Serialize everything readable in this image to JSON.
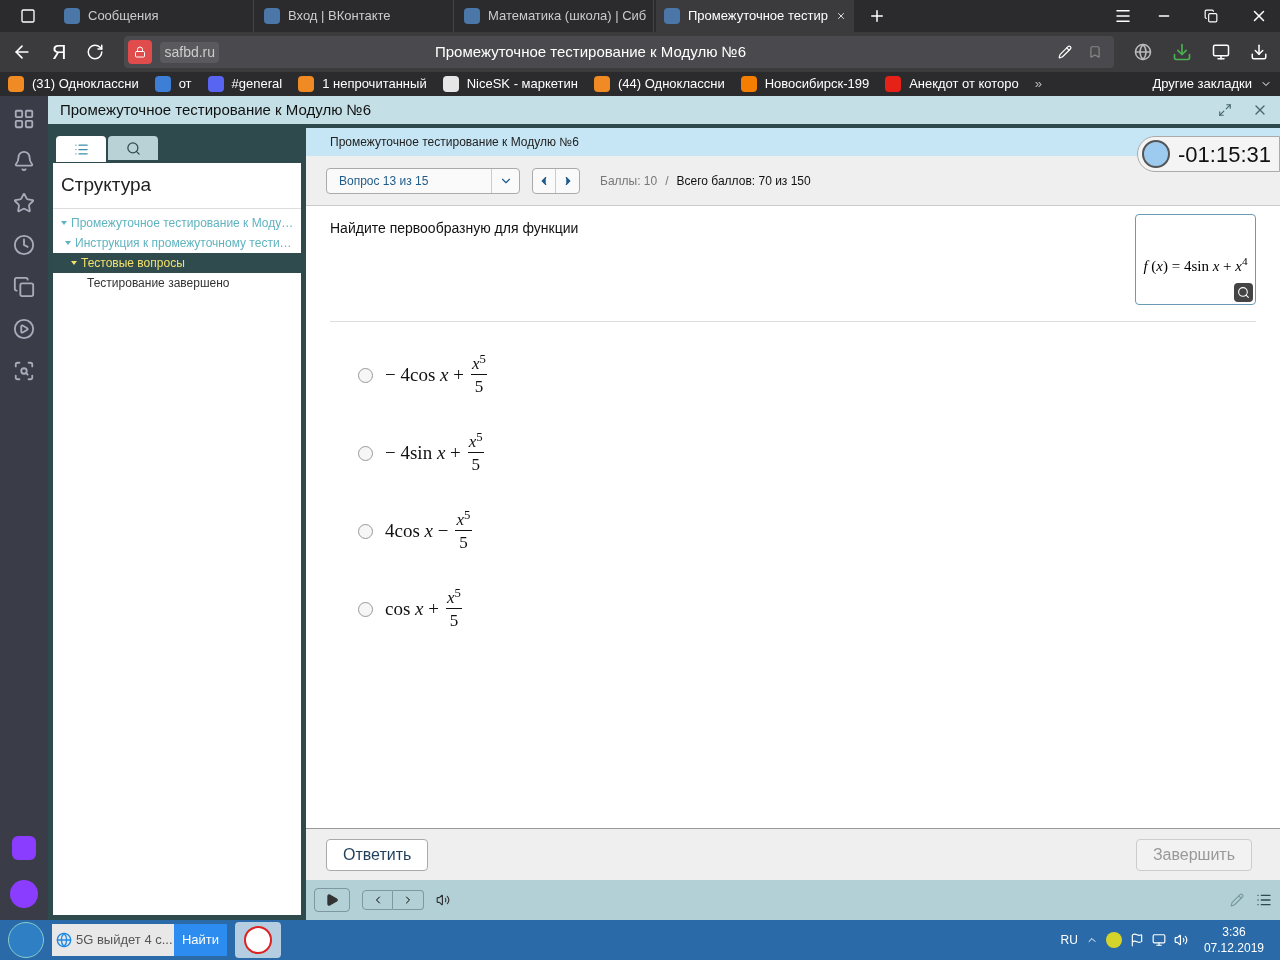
{
  "browser_tabs": [
    {
      "label": "Сообщения",
      "selected": false
    },
    {
      "label": "Вход | ВКонтакте",
      "selected": false
    },
    {
      "label": "Математика (школа) | Сиб",
      "selected": false
    },
    {
      "label": "Промежуточное тестир",
      "selected": true
    }
  ],
  "address_bar": {
    "domain": "safbd.ru",
    "page_title": "Промежуточное тестирование к Модулю №6"
  },
  "bookmarks": [
    {
      "label": "(31) Одноклассни",
      "color": "#f08a24"
    },
    {
      "label": "от",
      "color": "#3d7fd6"
    },
    {
      "label": "#general",
      "color": "#5865f2"
    },
    {
      "label": "1 непрочитанный",
      "color": "#f08a24"
    },
    {
      "label": "NiceSK - маркетин",
      "color": "#e6e6e6"
    },
    {
      "label": "(44) Одноклассни",
      "color": "#f08a24"
    },
    {
      "label": "Новосибирск-199",
      "color": "#f57d00"
    },
    {
      "label": "Анекдот от которо",
      "color": "#e62117"
    }
  ],
  "more_bookmarks": "»",
  "other_bookmarks": "Другие закладки",
  "browser_logo": "Я",
  "window": {
    "title": "Промежуточное тестирование к Модулю №6"
  },
  "panel_tabs": [
    {
      "kind": "list",
      "selected": true
    },
    {
      "kind": "search",
      "selected": false
    }
  ],
  "structure": {
    "title": "Структура",
    "items": [
      {
        "label": "Промежуточное тестирование к Моду…",
        "expanded": true,
        "selected": false,
        "children": [
          {
            "label": "Инструкция к промежуточному тести…",
            "expanded": true,
            "selected": false,
            "children": [
              {
                "label": "Тестовые вопросы",
                "expanded": true,
                "selected": true,
                "children": [
                  {
                    "label": "Тестирование завершено",
                    "expanded": false,
                    "selected": false
                  }
                ]
              }
            ]
          }
        ]
      }
    ]
  },
  "header": {
    "title": "Промежуточное тестирование к Модулю №6",
    "question_select": "Вопрос 13 из 15",
    "score": "Баллы: 10",
    "separator": "/",
    "total": "Всего баллов: 70 из 150",
    "timer": "-01:15:31"
  },
  "question": {
    "text": "Найдите первообразную для функции",
    "formula": "*f* (*x*) = 4sin *x* + *x*$^{4}$"
  },
  "options": [
    {
      "lead": "− 4cos *x* +",
      "numerator": "*x*$^{5}$",
      "denominator": "5",
      "selected": false
    },
    {
      "lead": "− 4sin *x* +",
      "numerator": "*x*$^{5}$",
      "denominator": "5",
      "selected": false
    },
    {
      "lead": "4cos *x* −",
      "numerator": "*x*$^{5}$",
      "denominator": "5",
      "selected": false
    },
    {
      "lead": "cos *x* +",
      "numerator": "*x*$^{5}$",
      "denominator": "5",
      "selected": false
    }
  ],
  "buttons": {
    "answer": "Ответить",
    "finish": "Завершить",
    "finish_disabled": true
  },
  "taskbar": {
    "search_value": "5G выйдет 4 с...",
    "search_button": "Найти",
    "language": "RU",
    "time": "3:36",
    "date": "07.12.2019"
  }
}
